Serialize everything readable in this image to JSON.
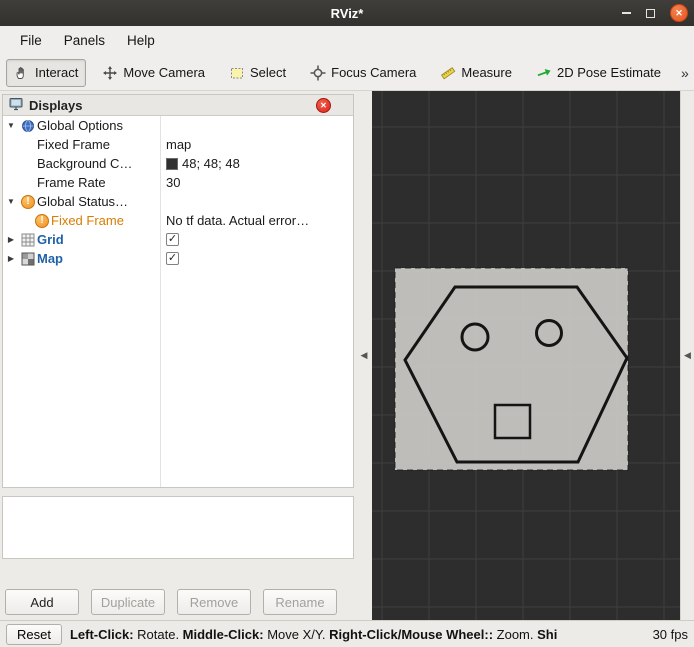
{
  "window": {
    "title": "RViz*"
  },
  "menu": {
    "items": [
      {
        "label": "File"
      },
      {
        "label": "Panels"
      },
      {
        "label": "Help"
      }
    ]
  },
  "toolbar": {
    "tools": [
      {
        "label": "Interact",
        "active": true
      },
      {
        "label": "Move Camera"
      },
      {
        "label": "Select"
      },
      {
        "label": "Focus Camera"
      },
      {
        "label": "Measure"
      },
      {
        "label": "2D Pose Estimate"
      }
    ],
    "overflow": "»"
  },
  "displays": {
    "title": "Displays",
    "rows": [
      {
        "label": "Global Options"
      },
      {
        "label": "Fixed Frame",
        "value": "map"
      },
      {
        "label": "Background C…",
        "value": "48; 48; 48",
        "swatch_color": "#303030"
      },
      {
        "label": "Frame Rate",
        "value": "30"
      },
      {
        "label": "Global Status…"
      },
      {
        "label": "Fixed Frame",
        "value": "No tf data.  Actual error…"
      },
      {
        "label": "Grid",
        "checked": true
      },
      {
        "label": "Map",
        "checked": true
      }
    ],
    "buttons": [
      {
        "label": "Add",
        "enabled": true
      },
      {
        "label": "Duplicate",
        "enabled": false
      },
      {
        "label": "Remove",
        "enabled": false
      },
      {
        "label": "Rename",
        "enabled": false
      }
    ]
  },
  "status": {
    "reset": "Reset",
    "segments": [
      {
        "text": "Left-Click:"
      },
      {
        "text": " Rotate.  "
      },
      {
        "text": "Middle-Click:"
      },
      {
        "text": " Move X/Y.  "
      },
      {
        "text": "Right-Click/Mouse Wheel::"
      },
      {
        "text": " Zoom.  "
      },
      {
        "text": "Shi"
      }
    ],
    "fps": "30 fps"
  },
  "icons": {
    "check": "✓",
    "arrow_expanded": "▼",
    "arrow_collapsed": "▶",
    "collapse_left": "◀",
    "warning": "!",
    "close": "✕"
  },
  "colors": {
    "close_button": "#E95420",
    "warning": "#EF9221",
    "display_link_blue": "#2062A8",
    "background_value": "#303030",
    "view_background": "#2D2D2D",
    "map_fill": "#C8C7C4"
  }
}
